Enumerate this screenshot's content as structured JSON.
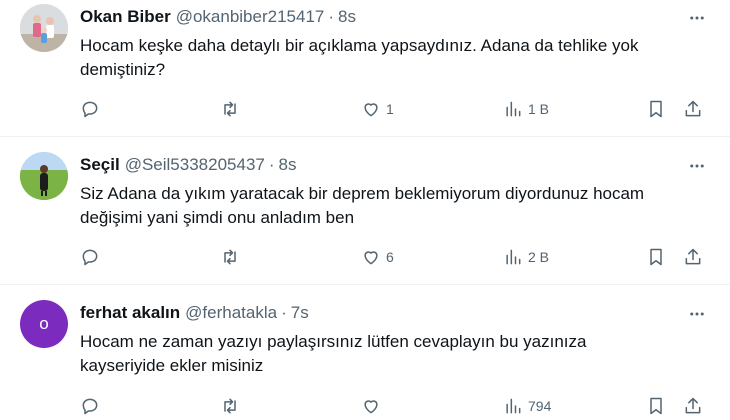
{
  "tweets": [
    {
      "name": "Okan Biber",
      "handle": "@okanbiber215417",
      "dot": "·",
      "time": "8s",
      "text_line1": "Hocam keşke daha detaylı bir açıklama yapsaydınız. Adana da tehlike yok",
      "text_line2": "demiştiniz?",
      "replies": "",
      "retweets": "",
      "likes": "1",
      "views": "1 B",
      "avatar": "photo"
    },
    {
      "name": "Seçil",
      "handle": "@Seil5338205437",
      "dot": "·",
      "time": "8s",
      "text_line1": "Siz Adana da yıkım yaratacak bir deprem beklemiyorum diyordunuz hocam",
      "text_line2": "değişimi yani şimdi onu anladım ben",
      "replies": "",
      "retweets": "",
      "likes": "6",
      "views": "2 B",
      "avatar": "photo"
    },
    {
      "name": "ferhat akalın",
      "handle": "@ferhatakla",
      "dot": "·",
      "time": "7s",
      "text_line1": "Hocam ne zaman yazıyı paylaşırsınız lütfen cevaplayın bu yazınıza",
      "text_line2": "kayseriyide ekler misiniz",
      "replies": "",
      "retweets": "",
      "likes": "",
      "views": "794",
      "avatar": "letter",
      "avatar_letter": "o",
      "avatar_color": "#7b2cbf"
    }
  ],
  "icons": {
    "reply": "reply-icon",
    "retweet": "retweet-icon",
    "like": "heart-icon",
    "views": "views-icon",
    "bookmark": "bookmark-icon",
    "share": "share-icon",
    "more": "more-options-icon"
  },
  "colors": {
    "text": "#0f1419",
    "secondary": "#536471",
    "divider": "#eff3f4"
  }
}
